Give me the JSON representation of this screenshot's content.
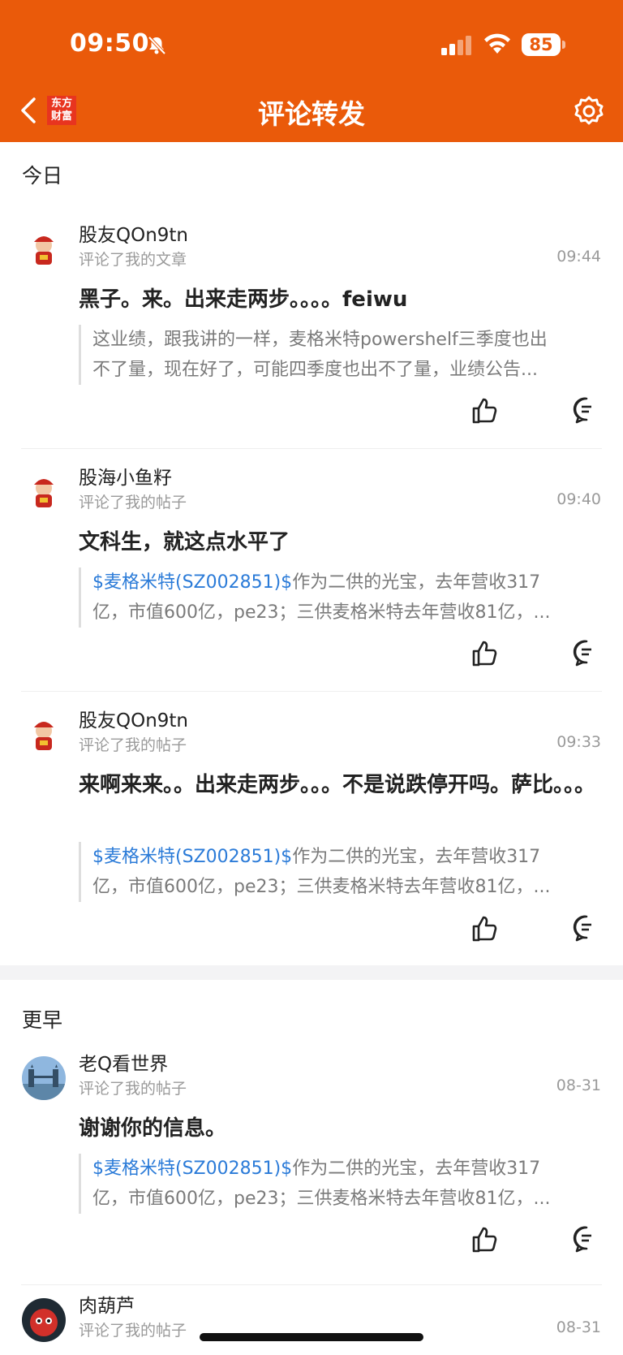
{
  "status_bar": {
    "time": "09:50",
    "battery": "85"
  },
  "nav": {
    "title": "评论转发",
    "logo_line1": "东方",
    "logo_line2": "财富"
  },
  "sections": [
    {
      "label": "今日"
    },
    {
      "label": "更早"
    }
  ],
  "items": [
    {
      "username": "股友QOn9tn",
      "action": "评论了我的文章",
      "time": "09:44",
      "comment": "黑子。来。出来走两步。。。。feiwu",
      "quote_stock": "",
      "quote_line1": "这业绩，跟我讲的一样，麦格米特powershelf三季度也出",
      "quote_line2": "不了量，现在好了，可能四季度也出不了量，业绩公告..."
    },
    {
      "username": "股海小鱼籽",
      "action": "评论了我的帖子",
      "time": "09:40",
      "comment": "文科生，就这点水平了",
      "quote_stock": "$麦格米特(SZ002851)$",
      "quote_line1": "作为二供的光宝，去年营收317",
      "quote_line2": "亿，市值600亿，pe23；三供麦格米特去年营收81亿，..."
    },
    {
      "username": "股友QOn9tn",
      "action": "评论了我的帖子",
      "time": "09:33",
      "comment": "来啊来来。。出来走两步。。。不是说跌停开吗。萨比。。。",
      "quote_stock": "$麦格米特(SZ002851)$",
      "quote_line1": "作为二供的光宝，去年营收317",
      "quote_line2": "亿，市值600亿，pe23；三供麦格米特去年营收81亿，..."
    },
    {
      "username": "老Q看世界",
      "action": "评论了我的帖子",
      "time": "08-31",
      "comment": "谢谢你的信息。",
      "quote_stock": "$麦格米特(SZ002851)$",
      "quote_line1": "作为二供的光宝，去年营收317",
      "quote_line2": "亿，市值600亿，pe23；三供麦格米特去年营收81亿，..."
    },
    {
      "username": "肉葫芦",
      "action": "评论了我的帖子",
      "time": "08-31"
    }
  ],
  "colors": {
    "accent": "#ea5a0a",
    "stock_link": "#2b7bd8"
  }
}
